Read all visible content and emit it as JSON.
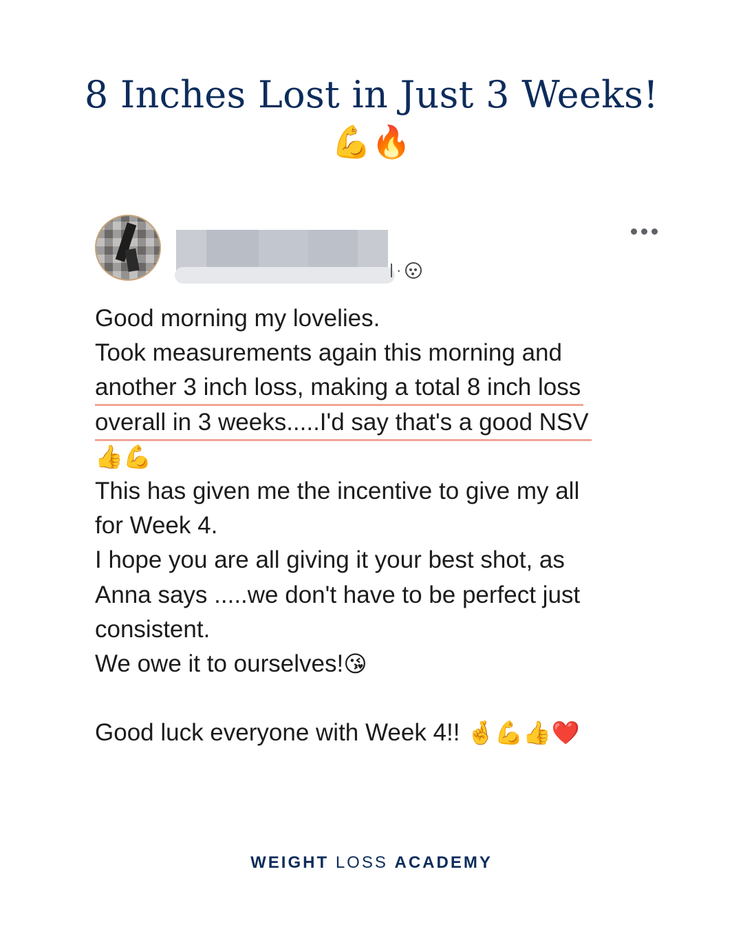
{
  "headline": {
    "title": "8 Inches Lost in Just 3 Weeks!",
    "emojis": "💪🔥"
  },
  "post": {
    "header": {
      "avatar": "blurred-avatar",
      "name_obscured": true,
      "separator": "·",
      "privacy_icon": "group-members-icon",
      "more_icon": "more-options-icon"
    },
    "lines": {
      "l1": "Good morning my lovelies.",
      "l2": "Took measurements again this morning and",
      "l3": "another 3 inch loss, making a total 8 inch loss",
      "l4": "overall in 3 weeks.....I'd say that's a good NSV",
      "l5_emoji": "👍💪",
      "l6": "This has given me the incentive to give my all",
      "l7": "for Week 4.",
      "l8": "I hope you are all giving it your best shot, as",
      "l9": "Anna says .....we don't have to be perfect just",
      "l10": "consistent.",
      "l11": "We owe it to ourselves!",
      "l11_emoji": "😘",
      "l12": "Good luck everyone with Week 4!!",
      "l12_emoji": "🤞💪👍❤️"
    },
    "highlight_color": "#f0a596"
  },
  "brand": {
    "part1": "WEIGHT",
    "part2": "LOSS",
    "part3": "ACADEMY",
    "color": "#0d2c5b"
  }
}
